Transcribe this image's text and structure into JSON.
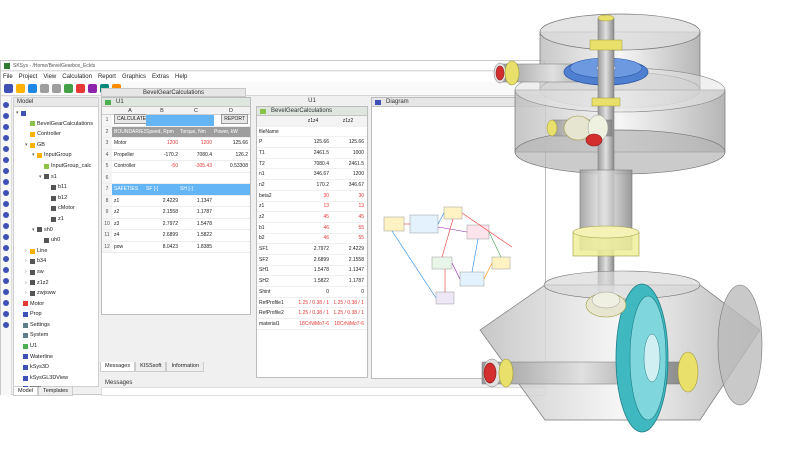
{
  "window": {
    "title": "SKSys - /Home/BevelGearbox_Eckts",
    "menu": [
      "File",
      "Project",
      "View",
      "Calculation",
      "Report",
      "Graphics",
      "Extras",
      "Help"
    ]
  },
  "model_panel": {
    "title": "Model",
    "tree": [
      {
        "label": "BevelGearCalculations",
        "depth": 1,
        "icon": "calc-icon",
        "color": "#8bc34a"
      },
      {
        "label": "Controller",
        "depth": 1,
        "icon": "controller-icon",
        "color": "#ffb300"
      },
      {
        "label": "GB",
        "depth": 1,
        "icon": "gearbox-icon",
        "color": "#ffb300",
        "arrow": "▾"
      },
      {
        "label": "InputGroup",
        "depth": 2,
        "icon": "group-icon",
        "color": "#ffb300",
        "arrow": "▾"
      },
      {
        "label": "InputGroup_calc",
        "depth": 3,
        "icon": "calc-icon",
        "color": "#8bc34a"
      },
      {
        "label": "s1",
        "depth": 3,
        "icon": "shaft-icon",
        "color": "#555",
        "arrow": "▾"
      },
      {
        "label": "b11",
        "depth": 4,
        "icon": "bearing-icon",
        "color": "#555"
      },
      {
        "label": "b12",
        "depth": 4,
        "icon": "bearing-icon",
        "color": "#555"
      },
      {
        "label": "cMotor",
        "depth": 4,
        "icon": "coupling-icon",
        "color": "#555"
      },
      {
        "label": "z1",
        "depth": 4,
        "icon": "gear-icon",
        "color": "#555"
      },
      {
        "label": "sh0",
        "depth": 2,
        "icon": "shaft-icon",
        "color": "#555",
        "arrow": "▾"
      },
      {
        "label": "uh0",
        "depth": 3,
        "icon": "shaft-icon",
        "color": "#555"
      },
      {
        "label": "Line",
        "depth": 1,
        "icon": "line-icon",
        "color": "#ffb300",
        "arrow": "›"
      },
      {
        "label": "b34",
        "depth": 1,
        "icon": "bearing-icon",
        "color": "#555",
        "arrow": "›"
      },
      {
        "label": "sw",
        "depth": 1,
        "icon": "shaft-icon",
        "color": "#555",
        "arrow": "›"
      },
      {
        "label": "z1z2",
        "depth": 1,
        "icon": "gear-pair-icon",
        "color": "#555",
        "arrow": "›"
      },
      {
        "label": "zwjsww",
        "depth": 1,
        "icon": "gear-pair-icon",
        "color": "#555",
        "arrow": "›"
      },
      {
        "label": "Motor",
        "depth": 0,
        "icon": "motor-icon",
        "color": "#e53935"
      },
      {
        "label": "Prop",
        "depth": 0,
        "icon": "prop-icon",
        "color": "#3f51b5"
      },
      {
        "label": "Settings",
        "depth": 0,
        "icon": "settings-icon",
        "color": "#607d8b"
      },
      {
        "label": "System",
        "depth": 0,
        "icon": "system-icon",
        "color": "#607d8b"
      },
      {
        "label": "U1",
        "depth": 0,
        "icon": "sheet-icon",
        "color": "#4caf50"
      },
      {
        "label": "Waterline",
        "depth": 0,
        "icon": "line-icon",
        "color": "#3f51b5"
      },
      {
        "label": "kSys3D",
        "depth": 0,
        "icon": "3d-icon",
        "color": "#3f51b5"
      },
      {
        "label": "kSysGL3DView",
        "depth": 0,
        "icon": "3d-icon",
        "color": "#3f51b5"
      },
      {
        "label": "prop",
        "depth": 0,
        "icon": "prop-icon",
        "color": "#3f51b5"
      }
    ],
    "tabs": [
      "Model",
      "Templates"
    ]
  },
  "u1": {
    "title": "U1",
    "col_headers": [
      "",
      "A",
      "B",
      "C",
      "D"
    ],
    "rows": [
      {
        "n": "1",
        "a": "CALCULATE",
        "b": "",
        "c": "",
        "d": "REPORT",
        "style": "buttons"
      },
      {
        "n": "2",
        "a": "BOUNDARIES",
        "b": "Speed, Rpm",
        "c": "Torque, Nm",
        "d": "Power, kW",
        "style": "header"
      },
      {
        "n": "3",
        "a": "Motor",
        "b": "1200",
        "c": "1200",
        "d": "125.66",
        "style": "red-bc"
      },
      {
        "n": "4",
        "a": "Propeller",
        "b": "-170.2",
        "c": "7080.4",
        "d": "126.2",
        "style": "plain"
      },
      {
        "n": "5",
        "a": "Controller",
        "b": "-50",
        "c": "-305.43",
        "d": "0.53308",
        "style": "red-bc"
      },
      {
        "n": "6",
        "a": "",
        "b": "",
        "c": "",
        "d": "",
        "style": "plain"
      },
      {
        "n": "7",
        "a": "SAFETIES",
        "b": "SF [-]",
        "c": "SH [-]",
        "d": "",
        "style": "safety"
      },
      {
        "n": "8",
        "a": "z1",
        "b": "2.4229",
        "c": "1.1347",
        "d": "",
        "style": "plain"
      },
      {
        "n": "9",
        "a": "z2",
        "b": "2.1558",
        "c": "1.1787",
        "d": "",
        "style": "plain"
      },
      {
        "n": "10",
        "a": "z3",
        "b": "2.7972",
        "c": "1.5478",
        "d": "",
        "style": "plain"
      },
      {
        "n": "11",
        "a": "z4",
        "b": "2.6899",
        "c": "1.5822",
        "d": "",
        "style": "plain"
      },
      {
        "n": "12",
        "a": "pow",
        "b": "8.0423",
        "c": "1.8385",
        "d": "",
        "style": "plain"
      }
    ]
  },
  "bgc": {
    "tab_title": "BevelGearCalculations",
    "col_title": "U1",
    "title": "BevelGearCalculations",
    "headers": [
      "",
      "z1z4",
      "z1z2"
    ],
    "rows": [
      {
        "k": "fileName",
        "v1": "",
        "v2": "",
        "red": false
      },
      {
        "k": "P",
        "v1": "125.66",
        "v2": "125.66",
        "red": false
      },
      {
        "k": "T1",
        "v1": "2461.5",
        "v2": "1000",
        "red": false
      },
      {
        "k": "T2",
        "v1": "7080.4",
        "v2": "2461.5",
        "red": false
      },
      {
        "k": "n1",
        "v1": "346.67",
        "v2": "1200",
        "red": false
      },
      {
        "k": "n2",
        "v1": "170.2",
        "v2": "346.67",
        "red": false
      },
      {
        "k": "beta2",
        "v1": "30",
        "v2": "30",
        "red": true
      },
      {
        "k": "z1",
        "v1": "13",
        "v2": "13",
        "red": true
      },
      {
        "k": "z2",
        "v1": "45",
        "v2": "45",
        "red": true
      },
      {
        "k": "b1",
        "v1": "46",
        "v2": "55",
        "red": true
      },
      {
        "k": "b2",
        "v1": "46",
        "v2": "55",
        "red": true
      },
      {
        "k": "SF1",
        "v1": "2.7972",
        "v2": "2.4229",
        "red": false
      },
      {
        "k": "SF2",
        "v1": "2.6899",
        "v2": "2.1558",
        "red": false
      },
      {
        "k": "SH1",
        "v1": "1.5478",
        "v2": "1.1347",
        "red": false
      },
      {
        "k": "SH2",
        "v1": "1.5822",
        "v2": "1.1787",
        "red": false
      },
      {
        "k": "Shint",
        "v1": "0",
        "v2": "0",
        "red": false
      },
      {
        "k": "RefProfile1",
        "v1": "1.25 / 0.38 / 1",
        "v2": "1.25 / 0.38 / 1",
        "red": true
      },
      {
        "k": "RefProfile2",
        "v1": "1.25 / 0.38 / 1",
        "v2": "1.25 / 0.38 / 1",
        "red": true
      },
      {
        "k": "material1",
        "v1": "18CrNiMo7-6",
        "v2": "18CrNiMo7-6",
        "red": true
      }
    ]
  },
  "diagram": {
    "title": "Diagram"
  },
  "messages": {
    "title": "Messages",
    "tabs": [
      "Messages",
      "KISSsoft",
      "Information"
    ]
  },
  "colors": {
    "housing": "#cfcfcf",
    "gear_blue": "#4f7fcf",
    "gear_teal": "#3fb8c0",
    "bearing_yellow": "#e8e06a",
    "cap_red": "#d32f2f"
  }
}
